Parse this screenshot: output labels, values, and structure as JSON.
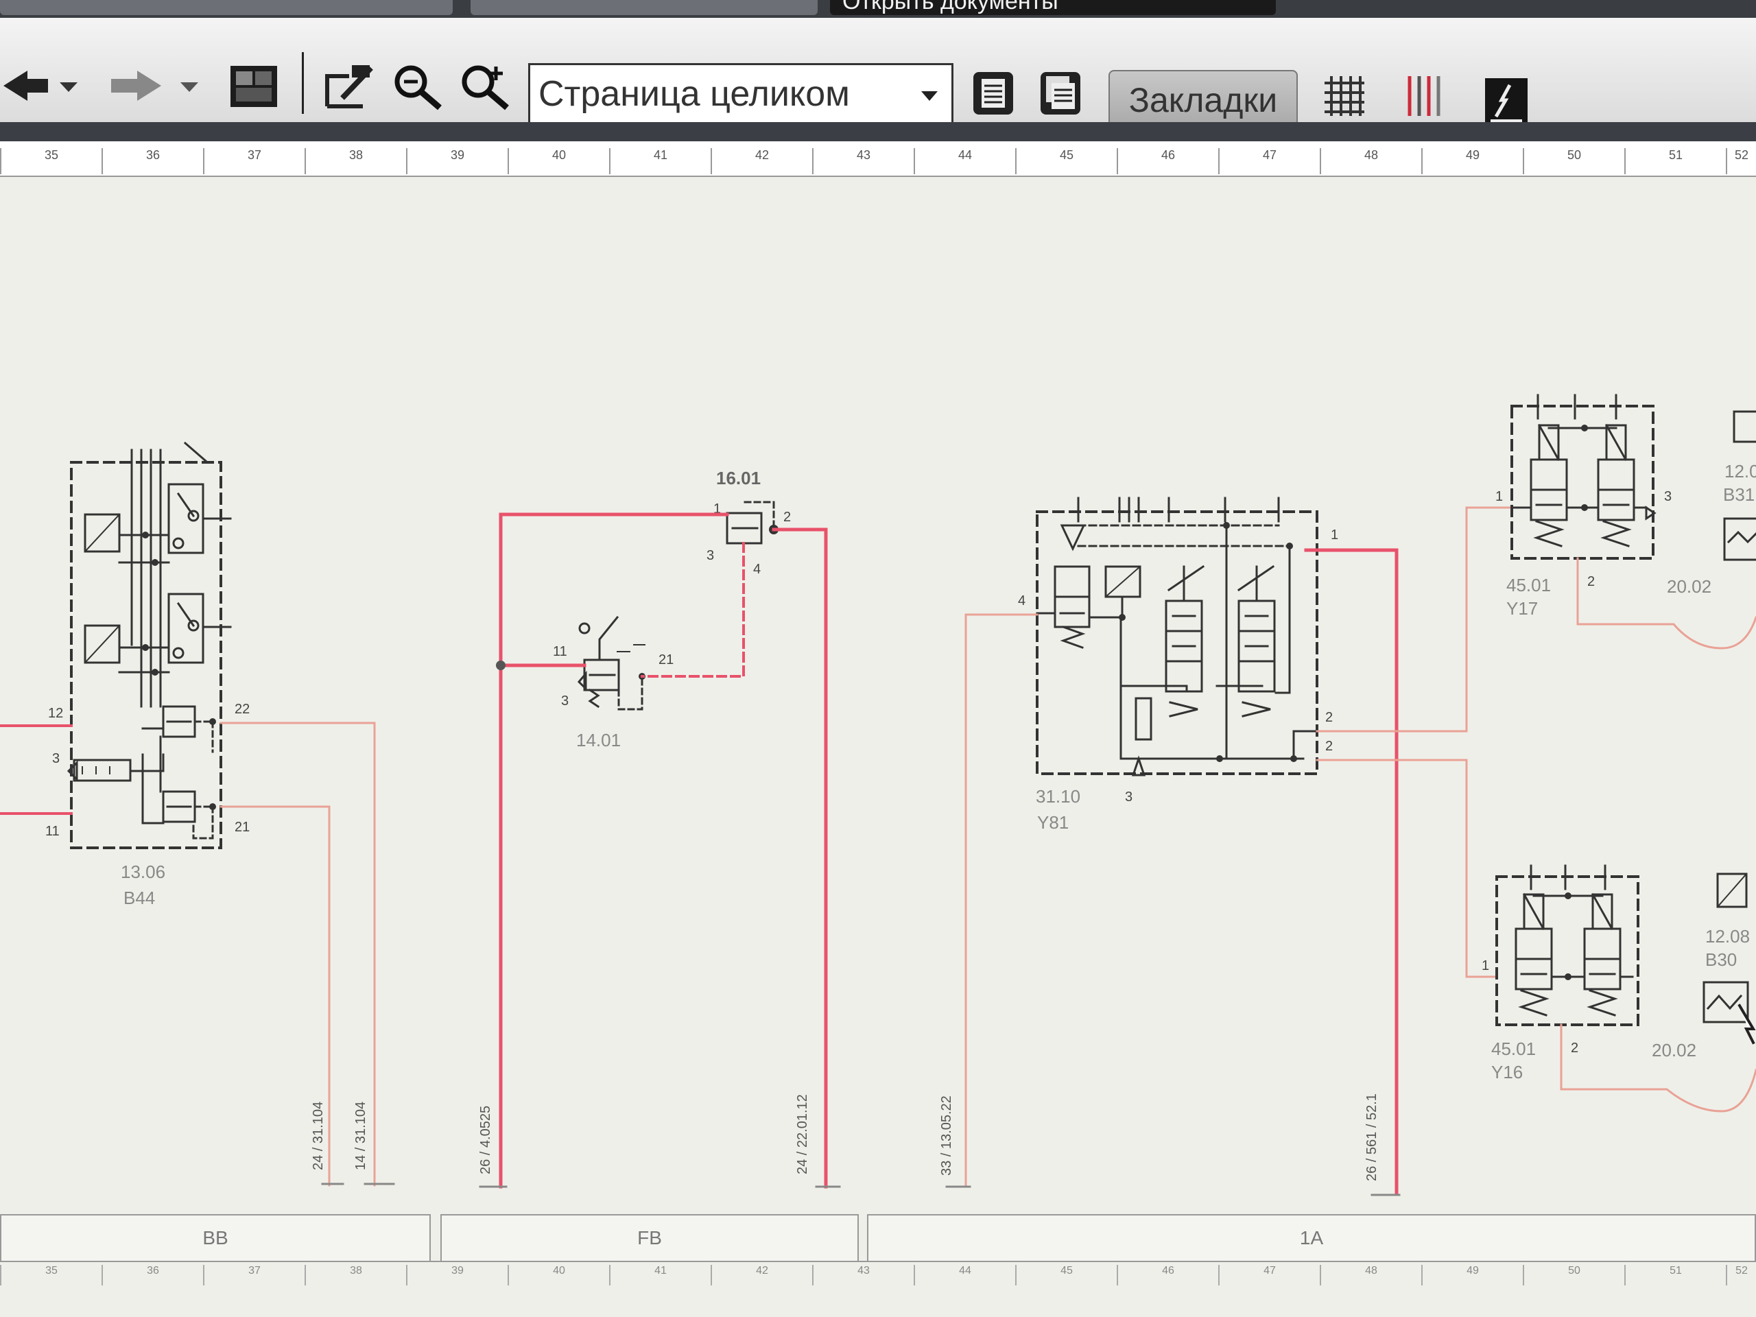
{
  "window_tab": {
    "label": "Открыть документы"
  },
  "toolbar": {
    "zoom_value": "Страница целиком",
    "bookmarks_label": "Закладки"
  },
  "ruler": {
    "columns": [
      "35",
      "36",
      "37",
      "38",
      "39",
      "40",
      "41",
      "42",
      "43",
      "44",
      "45",
      "46",
      "47",
      "48",
      "49",
      "50",
      "51",
      "52"
    ]
  },
  "components": [
    {
      "id": "13.06",
      "tag": "B44",
      "ports": [
        "12",
        "3",
        "11",
        "22",
        "21"
      ]
    },
    {
      "id": "16.01",
      "ports": [
        "1",
        "2",
        "3",
        "4"
      ]
    },
    {
      "id": "14.01",
      "ports": [
        "11",
        "21",
        "3"
      ]
    },
    {
      "id": "31.10",
      "tag": "Y81",
      "ports": [
        "4",
        "1",
        "2",
        "2",
        "3"
      ]
    },
    {
      "id": "45.01",
      "tag": "Y17",
      "ports": [
        "1",
        "3",
        "2"
      ],
      "ref": "20.02"
    },
    {
      "id": "12.0",
      "tag": "B31"
    },
    {
      "id": "45.01",
      "tag": "Y16",
      "ports": [
        "1",
        "2"
      ],
      "ref": "20.02"
    },
    {
      "id": "12.08",
      "tag": "B30"
    }
  ],
  "wire_refs": [
    "24 / 31.104",
    "14 / 31.104",
    "26 / 4.0525",
    "24 / 22.01.12",
    "33 / 13.05.22",
    "26 / 561 / 52.1"
  ],
  "zones": [
    "BB",
    "FB",
    "1A"
  ]
}
